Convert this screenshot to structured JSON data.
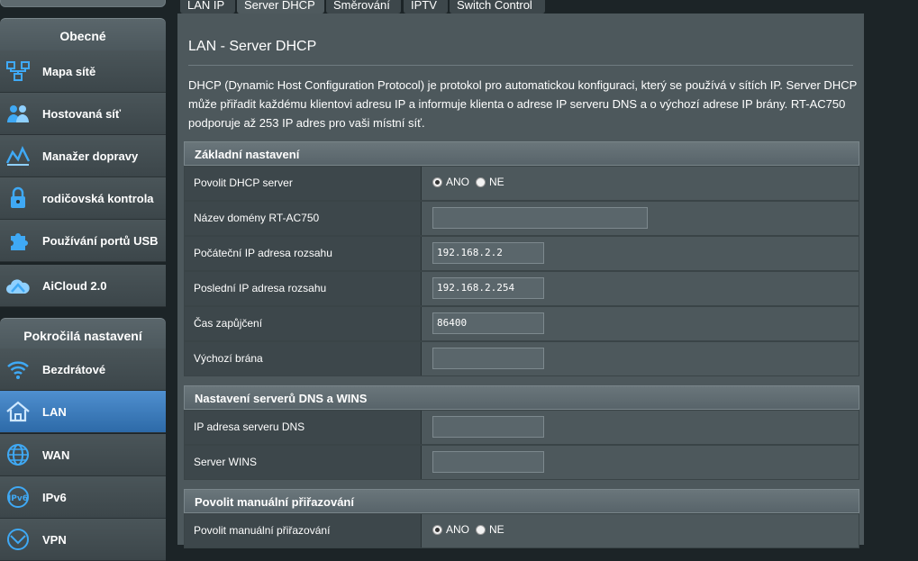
{
  "tabs": [
    {
      "label": "LAN IP"
    },
    {
      "label": "Server DHCP"
    },
    {
      "label": "Směrování"
    },
    {
      "label": "IPTV"
    },
    {
      "label": "Switch Control"
    }
  ],
  "sidebar": {
    "general_header": "Obecné",
    "general_items": [
      {
        "label": "Mapa sítě",
        "icon": "network-map-icon"
      },
      {
        "label": "Hostovaná síť",
        "icon": "guest-network-icon"
      },
      {
        "label": "Manažer dopravy",
        "icon": "traffic-manager-icon"
      },
      {
        "label": "rodičovská kontrola",
        "icon": "parental-control-icon"
      },
      {
        "label": "Používání portů USB",
        "icon": "usb-icon"
      },
      {
        "label": "AiCloud 2.0",
        "icon": "aicloud-icon"
      }
    ],
    "advanced_header": "Pokročilá nastavení",
    "advanced_items": [
      {
        "label": "Bezdrátové",
        "icon": "wifi-icon"
      },
      {
        "label": "LAN",
        "icon": "home-icon"
      },
      {
        "label": "WAN",
        "icon": "globe-icon"
      },
      {
        "label": "IPv6",
        "icon": "ipv6-icon"
      },
      {
        "label": "VPN",
        "icon": "vpn-icon"
      }
    ]
  },
  "main": {
    "title": "LAN - Server DHCP",
    "description": "DHCP (Dynamic Host Configuration Protocol) je protokol pro automatickou konfiguraci, který se používá v sítích IP. Server DHCP může přiřadit každému klientovi adresu IP a informuje klienta o adrese IP serveru DNS a o výchozí adrese IP brány. RT-AC750 podporuje až 253 IP adres pro vaši místní síť.",
    "sections": {
      "basic": {
        "header": "Základní nastavení",
        "enable_dhcp_label": "Povolit DHCP server",
        "radio_yes": "ANO",
        "radio_no": "NE",
        "domain_label": "Název domény RT-AC750",
        "domain_value": "",
        "start_ip_label": "Počáteční IP adresa rozsahu",
        "start_ip_value": "192.168.2.2",
        "end_ip_label": "Poslední IP adresa rozsahu",
        "end_ip_value": "192.168.2.254",
        "lease_label": "Čas zapůjčení",
        "lease_value": "86400",
        "gateway_label": "Výchozí brána",
        "gateway_value": ""
      },
      "dns": {
        "header": "Nastavení serverů DNS a WINS",
        "dns_label": "IP adresa serveru DNS",
        "dns_value": "",
        "wins_label": "Server WINS",
        "wins_value": ""
      },
      "manual": {
        "header": "Povolit manuální přiřazování",
        "manual_label": "Povolit manuální přiřazování",
        "radio_yes": "ANO",
        "radio_no": "NE"
      }
    }
  }
}
